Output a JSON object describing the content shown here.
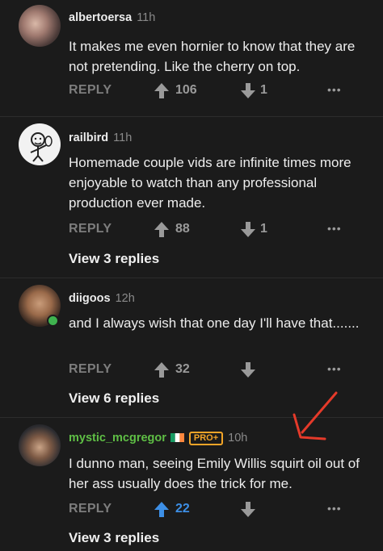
{
  "comments": [
    {
      "username": "albertoersa",
      "time": "11h",
      "text": "It makes me even hornier to know that they are not pretending. Like the cherry on top.",
      "reply_label": "REPLY",
      "upvotes": "106",
      "downvotes": "1",
      "more": "•••"
    },
    {
      "username": "railbird",
      "time": "11h",
      "text": "Homemade couple vids are infinite times more enjoyable to watch than any professional production ever made.",
      "reply_label": "REPLY",
      "upvotes": "88",
      "downvotes": "1",
      "more": "•••",
      "view_replies": "View 3 replies"
    },
    {
      "username": "diigoos",
      "time": "12h",
      "text": "and I always wish that one day I'll have that.......",
      "reply_label": "REPLY",
      "upvotes": "32",
      "downvotes": "",
      "more": "•••",
      "view_replies": "View 6 replies"
    },
    {
      "username": "mystic_mcgregor",
      "time": "10h",
      "badge": "PRO+",
      "text": "I dunno man, seeing Emily Willis squirt oil out of her ass usually does the trick for me.",
      "reply_label": "REPLY",
      "upvotes": "22",
      "downvotes": "",
      "more": "•••",
      "view_replies": "View 3 replies"
    }
  ],
  "colors": {
    "background": "#1b1b1b",
    "upvote_active": "#3d8fe6",
    "pro_badge": "#f3a528",
    "username_highlight": "#5fbf45",
    "annotation_arrow": "#e53a2a",
    "online_dot": "#3fb34f"
  }
}
